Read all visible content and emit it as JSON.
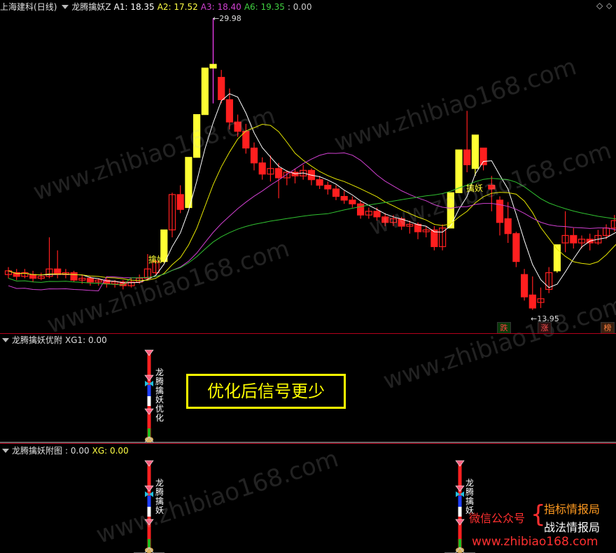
{
  "main": {
    "stock_name": "上海建科",
    "period": "(日线)",
    "indicator_name": "龙腾擒妖Z",
    "a1": "A1: 18.35",
    "a2": "A2: 17.52",
    "a3": "A3: 18.40",
    "a6": "A6: 19.35",
    "extra": ": 0.00",
    "high_label": "29.98",
    "low_label": "13.95",
    "signal_label": "擒妖",
    "cell_die": "跌",
    "cell_zhang": "涨",
    "cell_bang": "榜",
    "ctl_diamond": "◇",
    "ctl_arrows": "⬦"
  },
  "pane1": {
    "title": "龙腾擒妖优附",
    "value": "XG1: 0.00",
    "vertical_text": "龙腾擒妖优化",
    "notice": "优化后信号更少"
  },
  "pane2": {
    "title": "龙腾擒妖附图",
    "value": ": 0.00",
    "xg": "XG: 0.00",
    "vertical_text": "龙腾擒妖"
  },
  "promo": {
    "wechat": "微信公众号",
    "line1": "指标情报局",
    "line2": "战法情报局",
    "site": "www.zhibiao168.com"
  },
  "watermark": "www.zhibiao168.com",
  "colors": {
    "up": "#ff1f1f",
    "down_fill": "#ff1f1f",
    "limit": "#ffff33",
    "ma_white": "#ffffff",
    "ma_yellow": "#e6e600",
    "ma_magenta": "#d040d0",
    "ma_green": "#30c030",
    "separator": "#b3001b"
  },
  "chart_data": {
    "type": "candlestick",
    "price_range": [
      13.95,
      29.98
    ],
    "candles": [
      {
        "o": 16.2,
        "c": 16.4,
        "h": 16.6,
        "l": 16.0
      },
      {
        "o": 16.3,
        "c": 16.1,
        "h": 16.5,
        "l": 15.9
      },
      {
        "o": 16.1,
        "c": 16.3,
        "h": 16.5,
        "l": 16.0
      },
      {
        "o": 16.2,
        "c": 16.0,
        "h": 16.4,
        "l": 15.8
      },
      {
        "o": 16.0,
        "c": 16.1,
        "h": 16.3,
        "l": 15.9
      },
      {
        "o": 16.1,
        "c": 16.5,
        "h": 18.2,
        "l": 16.0
      },
      {
        "o": 16.5,
        "c": 16.2,
        "h": 17.5,
        "l": 16.0
      },
      {
        "o": 16.2,
        "c": 16.3,
        "h": 16.5,
        "l": 16.0
      },
      {
        "o": 16.3,
        "c": 15.9,
        "h": 16.4,
        "l": 15.8
      },
      {
        "o": 15.9,
        "c": 16.0,
        "h": 16.2,
        "l": 15.7
      },
      {
        "o": 16.0,
        "c": 15.8,
        "h": 16.1,
        "l": 15.6
      },
      {
        "o": 15.8,
        "c": 15.9,
        "h": 16.0,
        "l": 15.6
      },
      {
        "o": 15.9,
        "c": 15.7,
        "h": 16.0,
        "l": 15.5
      },
      {
        "o": 15.7,
        "c": 15.8,
        "h": 15.9,
        "l": 15.5
      },
      {
        "o": 15.8,
        "c": 15.6,
        "h": 15.9,
        "l": 15.4
      },
      {
        "o": 15.6,
        "c": 15.8,
        "h": 16.0,
        "l": 15.5
      },
      {
        "o": 15.8,
        "c": 16.0,
        "h": 16.2,
        "l": 15.7
      },
      {
        "o": 16.0,
        "c": 16.5,
        "h": 17.3,
        "l": 15.9
      },
      {
        "o": 16.3,
        "c": 16.9,
        "h": 17.0,
        "l": 16.2
      },
      {
        "o": 16.9,
        "c": 18.6,
        "h": 18.6,
        "l": 16.9,
        "lim": 1
      },
      {
        "o": 18.6,
        "c": 20.5,
        "h": 20.6,
        "l": 18.2
      },
      {
        "o": 20.5,
        "c": 19.7,
        "h": 21.0,
        "l": 19.5
      },
      {
        "o": 19.8,
        "c": 22.5,
        "h": 22.5,
        "l": 19.8,
        "lim": 1
      },
      {
        "o": 22.5,
        "c": 24.8,
        "h": 24.8,
        "l": 22.5,
        "lim": 1
      },
      {
        "o": 24.8,
        "c": 27.3,
        "h": 27.3,
        "l": 24.8,
        "lim": 1
      },
      {
        "o": 27.3,
        "c": 27.5,
        "h": 29.98,
        "l": 25.4,
        "lim": 1,
        "wick": 1
      },
      {
        "o": 26.8,
        "c": 25.6,
        "h": 27.2,
        "l": 25.4
      },
      {
        "o": 25.6,
        "c": 24.4,
        "h": 26.2,
        "l": 24.0
      },
      {
        "o": 24.4,
        "c": 23.9,
        "h": 24.8,
        "l": 23.6
      },
      {
        "o": 23.9,
        "c": 23.0,
        "h": 24.3,
        "l": 22.7
      },
      {
        "o": 23.0,
        "c": 22.2,
        "h": 23.3,
        "l": 21.8
      },
      {
        "o": 22.2,
        "c": 21.6,
        "h": 22.5,
        "l": 21.3
      },
      {
        "o": 21.6,
        "c": 21.9,
        "h": 22.6,
        "l": 21.2
      },
      {
        "o": 21.9,
        "c": 21.4,
        "h": 22.2,
        "l": 20.3
      },
      {
        "o": 21.4,
        "c": 21.7,
        "h": 21.8,
        "l": 21.0
      },
      {
        "o": 21.7,
        "c": 21.5,
        "h": 21.9,
        "l": 21.1
      },
      {
        "o": 21.5,
        "c": 21.8,
        "h": 22.1,
        "l": 21.3
      },
      {
        "o": 21.8,
        "c": 21.3,
        "h": 21.9,
        "l": 21.0
      },
      {
        "o": 21.3,
        "c": 21.0,
        "h": 21.5,
        "l": 20.8
      },
      {
        "o": 21.0,
        "c": 20.8,
        "h": 21.2,
        "l": 20.5
      },
      {
        "o": 20.8,
        "c": 20.4,
        "h": 21.0,
        "l": 20.2
      },
      {
        "o": 20.4,
        "c": 20.2,
        "h": 20.7,
        "l": 20.0
      },
      {
        "o": 20.2,
        "c": 20.0,
        "h": 20.4,
        "l": 19.8
      },
      {
        "o": 20.0,
        "c": 19.4,
        "h": 20.2,
        "l": 19.2
      },
      {
        "o": 19.4,
        "c": 19.6,
        "h": 19.8,
        "l": 19.2
      },
      {
        "o": 19.6,
        "c": 19.3,
        "h": 19.8,
        "l": 19.1
      },
      {
        "o": 19.3,
        "c": 19.0,
        "h": 19.5,
        "l": 18.8
      },
      {
        "o": 19.0,
        "c": 19.2,
        "h": 19.4,
        "l": 18.8
      },
      {
        "o": 19.2,
        "c": 18.8,
        "h": 19.3,
        "l": 18.6
      },
      {
        "o": 18.8,
        "c": 18.9,
        "h": 19.1,
        "l": 18.4
      },
      {
        "o": 18.9,
        "c": 18.5,
        "h": 19.0,
        "l": 18.1
      },
      {
        "o": 18.5,
        "c": 18.6,
        "h": 18.8,
        "l": 18.2
      },
      {
        "o": 18.6,
        "c": 17.7,
        "h": 18.8,
        "l": 17.5
      },
      {
        "o": 17.7,
        "c": 18.7,
        "h": 18.9,
        "l": 17.5
      },
      {
        "o": 18.7,
        "c": 20.6,
        "h": 20.6,
        "l": 18.7,
        "lim": 1
      },
      {
        "o": 20.6,
        "c": 22.9,
        "h": 22.9,
        "l": 20.6,
        "lim": 1
      },
      {
        "o": 22.9,
        "c": 22.1,
        "h": 25.0,
        "l": 21.7
      },
      {
        "o": 21.9,
        "c": 23.7,
        "h": 23.7,
        "l": 21.5,
        "lim": 1
      },
      {
        "o": 23.0,
        "c": 22.1,
        "h": 23.0,
        "l": 21.8
      },
      {
        "o": 21.0,
        "c": 20.8,
        "h": 21.5,
        "l": 19.6
      },
      {
        "o": 20.2,
        "c": 19.0,
        "h": 20.4,
        "l": 18.3
      },
      {
        "o": 19.2,
        "c": 18.4,
        "h": 20.1,
        "l": 17.9
      },
      {
        "o": 18.4,
        "c": 16.9,
        "h": 18.5,
        "l": 16.6
      },
      {
        "o": 16.2,
        "c": 15.0,
        "h": 16.5,
        "l": 14.8
      },
      {
        "o": 15.1,
        "c": 14.4,
        "h": 16.1,
        "l": 14.3
      },
      {
        "o": 14.7,
        "c": 14.9,
        "h": 15.5,
        "l": 14.4
      },
      {
        "o": 15.4,
        "c": 16.3,
        "h": 16.6,
        "l": 15.2
      },
      {
        "o": 16.4,
        "c": 17.8,
        "h": 17.8,
        "l": 16.3,
        "lim": 1
      },
      {
        "o": 17.9,
        "c": 18.3,
        "h": 19.6,
        "l": 17.4
      },
      {
        "o": 18.3,
        "c": 17.9,
        "h": 18.7,
        "l": 17.6
      },
      {
        "o": 17.9,
        "c": 18.1,
        "h": 18.3,
        "l": 17.6
      },
      {
        "o": 18.1,
        "c": 17.9,
        "h": 18.4,
        "l": 17.5
      },
      {
        "o": 17.9,
        "c": 18.3,
        "h": 18.6,
        "l": 17.8
      },
      {
        "o": 18.3,
        "c": 18.7,
        "h": 18.9,
        "l": 18.1
      },
      {
        "o": 18.7,
        "c": 19.1,
        "h": 19.4,
        "l": 18.5
      },
      {
        "o": 19.1,
        "c": 19.4,
        "h": 19.6,
        "l": 18.6
      }
    ],
    "signals": [
      {
        "index": 18,
        "label": "擒妖"
      },
      {
        "index": 56,
        "label": "擒妖"
      }
    ]
  }
}
